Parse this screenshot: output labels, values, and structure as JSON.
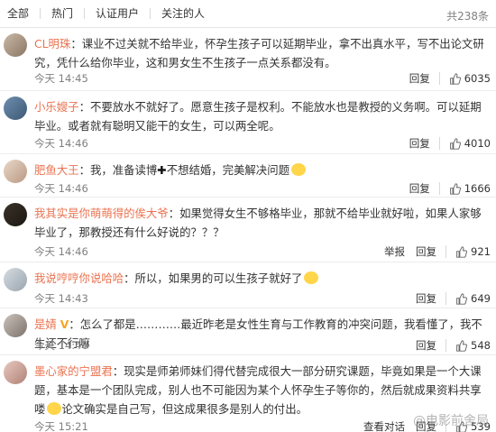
{
  "tabs": [
    "全部",
    "热门",
    "认证用户",
    "关注的人"
  ],
  "total": "共238条",
  "actions": {
    "reply": "回复",
    "report": "举报",
    "view_dialog": "查看对话"
  },
  "comments": [
    {
      "user": "CL明珠",
      "text": "：课业不过关就不给毕业，怀孕生孩子可以延期毕业，拿不出真水平，写不出论文研究，凭什么给你毕业，这和男女生不生孩子一点关系都没有。",
      "time": "今天 14:45",
      "likes": "6035"
    },
    {
      "user": "小乐嫂子",
      "text": "：不要放水不就好了。愿意生孩子是权利。不能放水也是教授的义务啊。可以延期毕业。或者就有聪明又能干的女生，可以两全呢。",
      "time": "今天 14:46",
      "likes": "4010"
    },
    {
      "user": "肥鱼大王",
      "text_a": "：我，准备读博",
      "text_b": "不想结婚，完美解决问题",
      "time": "今天 14:46",
      "likes": "1666"
    },
    {
      "user": "我其实是你萌萌得的俟大爷",
      "text": "：如果觉得女生不够格毕业，那就不给毕业就好啦，如果人家够毕业了，那教授还有什么好说的？？？",
      "time": "今天 14:46",
      "likes": "921"
    },
    {
      "user": "我说哼哼你说哈哈",
      "text": "：所以，如果男的可以生孩子就好了",
      "time": "今天 14:43",
      "likes": "649"
    },
    {
      "user": "是婧",
      "badge": "V",
      "text": "：怎么了都是…………最近昨老是女性生育与工作教育的冲突问题，我看懂了，我不生还不行嘛",
      "time": "今天 14:46",
      "likes": "548"
    },
    {
      "user": "墨心家的宁盟君",
      "text_a": "：现实是师弟师妹们得代替完成很大一部分研究课题，毕竟如果是一个大课题，基本是一个团队完成，别人也不可能因为某个人怀孕生子等你的，然后就成果资料共享喽",
      "text_b": "论文确实是自己写，但这成果很多是别人的付出。",
      "time": "今天 15:21",
      "likes": "539"
    }
  ],
  "watermark": "@电影前舍局"
}
